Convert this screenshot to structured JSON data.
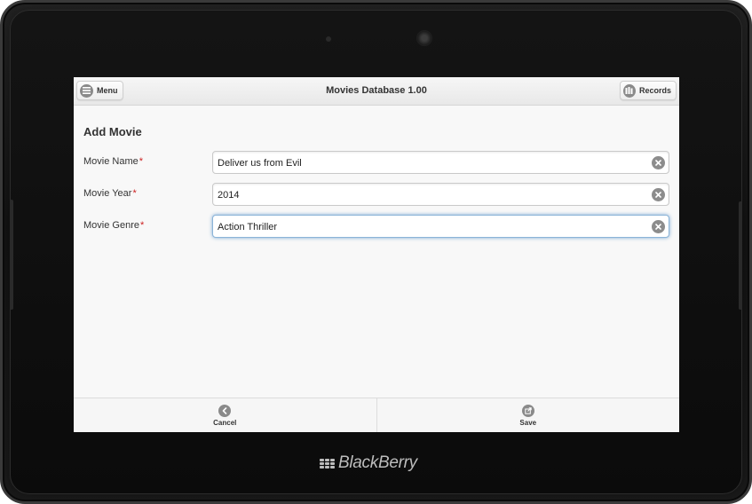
{
  "header": {
    "title": "Movies Database 1.00",
    "menu_label": "Menu",
    "records_label": "Records",
    "menu_icon": "menu-icon",
    "records_icon": "records-icon"
  },
  "form": {
    "title": "Add Movie",
    "required_marker": "*",
    "fields": [
      {
        "label": "Movie Name",
        "value": "Deliver us from Evil",
        "focused": false
      },
      {
        "label": "Movie Year",
        "value": "2014",
        "focused": false
      },
      {
        "label": "Movie Genre",
        "value": "Action Thriller",
        "focused": true
      }
    ],
    "clear_icon": "clear-icon"
  },
  "footer": {
    "cancel_label": "Cancel",
    "save_label": "Save",
    "cancel_icon": "back-arrow-icon",
    "save_icon": "export-icon"
  },
  "device": {
    "brand": "BlackBerry"
  },
  "colors": {
    "required": "#cc1f1f",
    "focus_border": "#8bb4d8",
    "icon_bg": "#8a8a8a"
  }
}
